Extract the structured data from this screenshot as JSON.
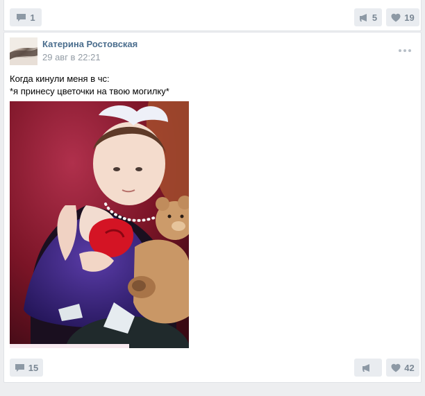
{
  "prev_post": {
    "comments_count": "1",
    "shares_count": "5",
    "likes_count": "19"
  },
  "post": {
    "author": "Катерина Ростовская",
    "date": "29 авг в 22:21",
    "text_lines": [
      "Когда кинули меня в чс:",
      "*я принесу цветочки на твою могилку*"
    ],
    "comments_count": "15",
    "shares_count": "",
    "likes_count": "42"
  },
  "icons": {
    "comment": "comment-icon",
    "share": "megaphone-icon",
    "like": "heart-icon",
    "more": "more-dots-icon"
  },
  "colors": {
    "author_link": "#4a6d8d",
    "muted": "#939ca5",
    "pill_bg": "#e9ecf0",
    "pill_fg": "#7a8794",
    "page_bg": "#edeef0"
  }
}
